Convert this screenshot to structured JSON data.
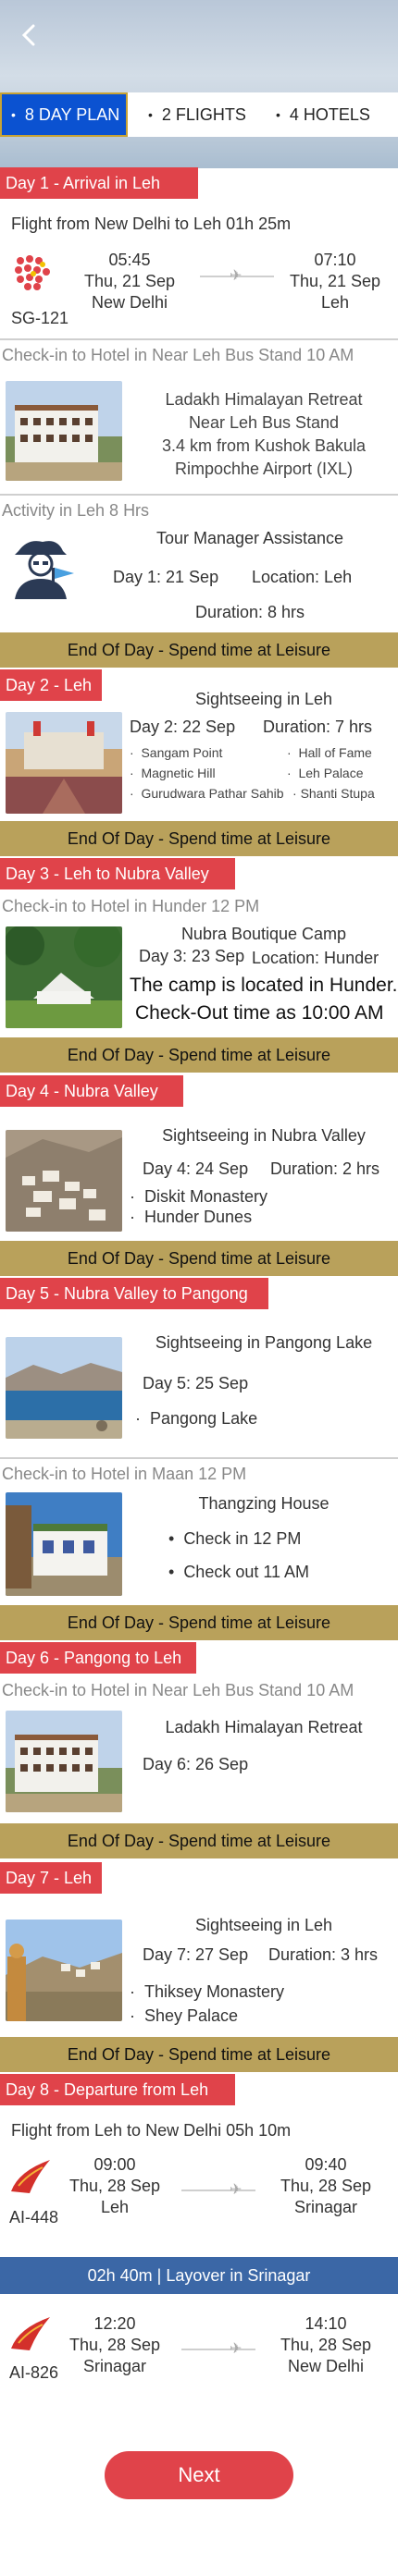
{
  "tabs": [
    {
      "label": "8 DAY PLAN"
    },
    {
      "label": "2 FLIGHTS"
    },
    {
      "label": "4 HOTELS"
    }
  ],
  "day1": {
    "title": "Day 1 - Arrival in Leh",
    "flight_title": "Flight from New Delhi to Leh 01h 25m",
    "flight_code": "SG-121",
    "dep_time": "05:45",
    "dep_date": "Thu, 21 Sep",
    "dep_city": "New Delhi",
    "arr_time": "07:10",
    "arr_date": "Thu, 21 Sep",
    "arr_city": "Leh",
    "checkin": "Check-in to Hotel in Near Leh Bus Stand 10 AM",
    "hotel_name": "Ladakh Himalayan Retreat",
    "hotel_line2": "Near Leh Bus Stand",
    "hotel_line3": "3.4 km from Kushok Bakula",
    "hotel_line4": "Rimpochhe Airport (IXL)",
    "activity_label": "Activity in Leh 8 Hrs",
    "activity_name": "Tour Manager Assistance",
    "activity_day": "Day 1: 21 Sep",
    "activity_location": "Location: Leh",
    "activity_duration": "Duration: 8 hrs"
  },
  "eod": "End Of Day - Spend time at Leisure",
  "day2": {
    "title": "Day 2 - Leh",
    "name": "Sightseeing in Leh",
    "day": "Day 2: 22 Sep",
    "duration": "Duration: 7 hrs",
    "places": [
      "Sangam Point",
      "Hall of Fame",
      "Magnetic Hill",
      "Leh Palace",
      "Gurudwara Pathar Sahib",
      "Shanti Stupa"
    ]
  },
  "day3": {
    "title": "Day 3 - Leh to Nubra Valley",
    "checkin": "Check-in to Hotel in Hunder 12 PM",
    "hotel_name": "Nubra Boutique Camp",
    "day": "Day 3: 23 Sep",
    "location": "Location: Hunder",
    "note1": "The camp is located in Hunder.",
    "note2": "Check-Out time as 10:00 AM"
  },
  "day4": {
    "title": "Day 4 - Nubra Valley",
    "name": "Sightseeing in Nubra Valley",
    "day": "Day 4: 24 Sep",
    "duration": "Duration: 2 hrs",
    "places": [
      "Diskit Monastery",
      "Hunder Dunes"
    ]
  },
  "day5": {
    "title": "Day 5 - Nubra Valley to Pangong",
    "name": "Sightseeing in Pangong Lake",
    "day": "Day 5: 25 Sep",
    "places": [
      "Pangong Lake"
    ],
    "checkin": "Check-in to Hotel in Maan 12 PM",
    "hotel_name": "Thangzing House",
    "hotel_items": [
      "Check in 12 PM",
      "Check out 11 AM"
    ]
  },
  "day6": {
    "title": "Day 6 - Pangong to Leh",
    "checkin": "Check-in to Hotel in Near Leh Bus Stand 10 AM",
    "hotel_name": "Ladakh Himalayan Retreat",
    "day": "Day 6: 26 Sep"
  },
  "day7": {
    "title": "Day 7 - Leh",
    "name": "Sightseeing in Leh",
    "day": "Day 7: 27 Sep",
    "duration": "Duration: 3 hrs",
    "places": [
      "Thiksey Monastery",
      "Shey Palace"
    ]
  },
  "day8": {
    "title": "Day 8 - Departure from Leh",
    "flight_title": "Flight from Leh to New Delhi 05h 10m",
    "f1": {
      "code": "AI-448",
      "dep_time": "09:00",
      "dep_date": "Thu, 28 Sep",
      "dep_city": "Leh",
      "arr_time": "09:40",
      "arr_date": "Thu, 28 Sep",
      "arr_city": "Srinagar"
    },
    "layover": "02h 40m | Layover in Srinagar",
    "f2": {
      "code": "AI-826",
      "dep_time": "12:20",
      "dep_date": "Thu, 28 Sep",
      "dep_city": "Srinagar",
      "arr_time": "14:10",
      "arr_date": "Thu, 28 Sep",
      "arr_city": "New Delhi"
    }
  },
  "next_label": "Next",
  "colors": {
    "red": "#e0434a",
    "gold": "#b9a15b",
    "blue": "#0b52d1",
    "layover": "#3b67a6"
  }
}
